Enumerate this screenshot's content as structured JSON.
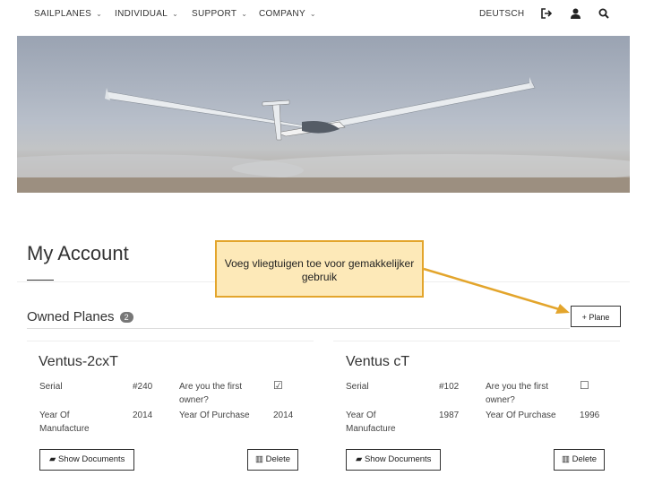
{
  "nav": {
    "items": [
      {
        "label": "SAILPLANES",
        "chevron": "⌄"
      },
      {
        "label": "INDIVIDUAL",
        "chevron": "⌄"
      },
      {
        "label": "SUPPORT",
        "chevron": "⌄"
      },
      {
        "label": "COMPANY",
        "chevron": "⌄"
      }
    ],
    "language": "DEUTSCH",
    "icons": [
      "logout-icon",
      "user-icon",
      "search-icon"
    ]
  },
  "page": {
    "title": "My Account",
    "section_title": "Owned Planes",
    "plane_count": "2",
    "add_plane_label": "+ Plane"
  },
  "callout": {
    "text": "Voeg vliegtuigen toe voor gemakkelijker gebruik",
    "color": "#e3a52c",
    "fill": "#fde9b8"
  },
  "planes": [
    {
      "name": "Ventus-2cxT",
      "serial_label": "Serial",
      "serial": "#240",
      "first_owner_label": "Are you the first owner?",
      "first_owner": "☑",
      "year_mfg_label": "Year Of Manufacture",
      "year_mfg": "2014",
      "year_purchase_label": "Year Of Purchase",
      "year_purchase": "2014",
      "docs_label": "Show Documents",
      "delete_label": "Delete"
    },
    {
      "name": "Ventus cT",
      "serial_label": "Serial",
      "serial": "#102",
      "first_owner_label": "Are you the first owner?",
      "first_owner": "☐",
      "year_mfg_label": "Year Of Manufacture",
      "year_mfg": "1987",
      "year_purchase_label": "Year Of Purchase",
      "year_purchase": "1996",
      "docs_label": "Show Documents",
      "delete_label": "Delete"
    }
  ]
}
